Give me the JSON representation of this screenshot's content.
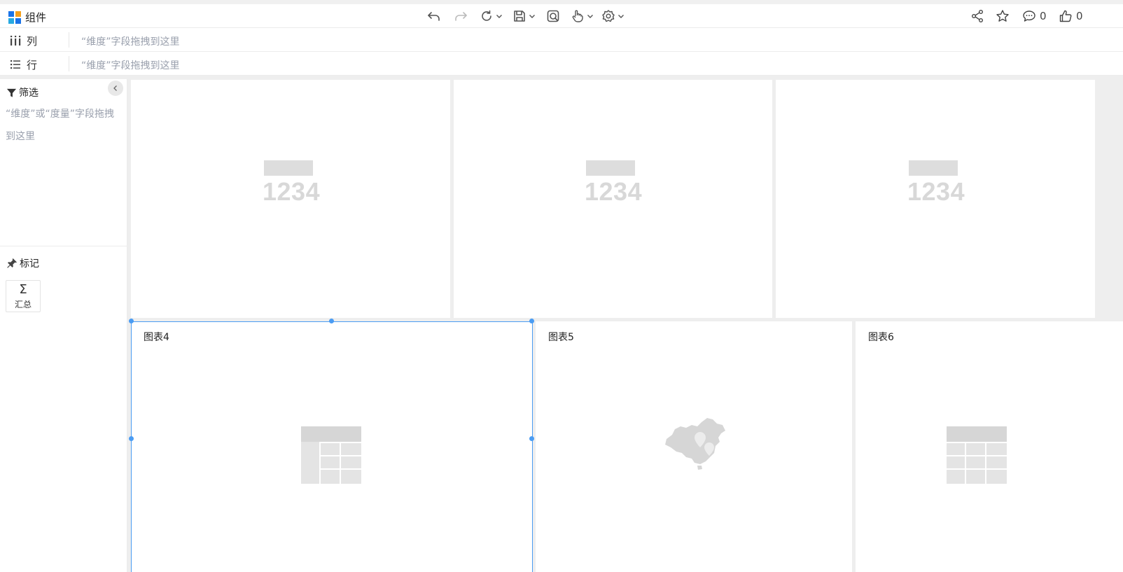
{
  "toolbar": {
    "brand_label": "组件",
    "comment_count": "0",
    "like_count": "0"
  },
  "shelves": {
    "columns": {
      "label": "列",
      "hint": "“维度”字段拖拽到这里"
    },
    "rows": {
      "label": "行",
      "hint": "“维度”字段拖拽到这里"
    }
  },
  "left_panel": {
    "filter_title": "筛选",
    "filter_hint": "“维度”或“度量”字段拖拽到这里",
    "marks_title": "标记",
    "sum_glyph": "Σ",
    "sum_label": "汇总"
  },
  "cards": {
    "kpi": [
      "1234",
      "1234",
      "1234"
    ],
    "chart4_title": "图表4",
    "chart5_title": "图表5",
    "chart6_title": "图表6"
  },
  "colors": {
    "accent": "#4a9cf3",
    "placeholder_gray": "#d8d8d8"
  }
}
